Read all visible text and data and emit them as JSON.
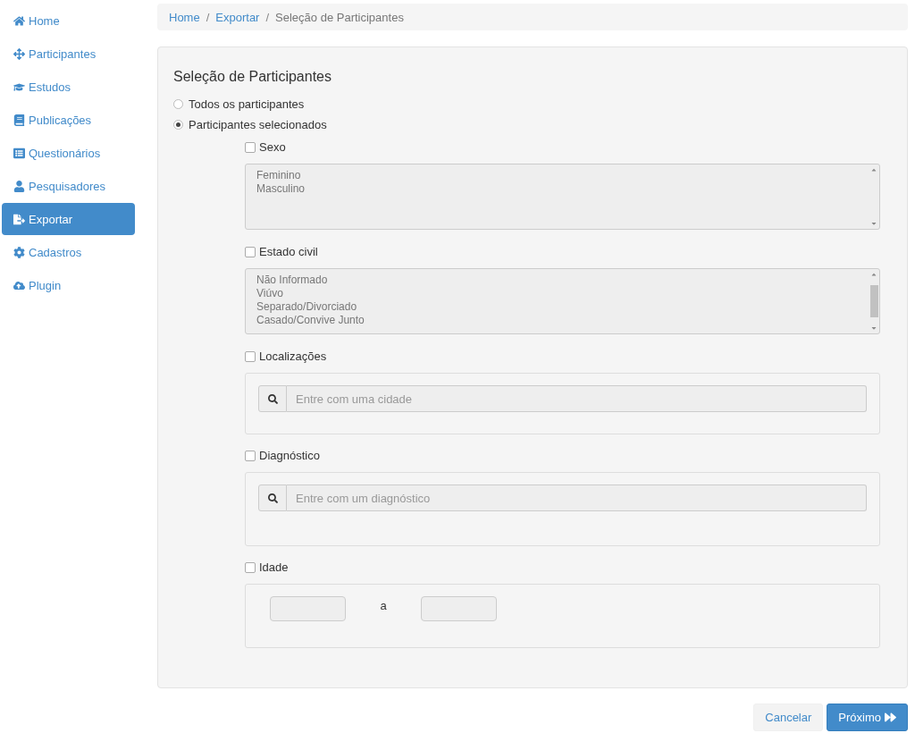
{
  "sidebar": {
    "items": [
      {
        "label": "Home",
        "kind": "home",
        "selected": false
      },
      {
        "label": "Participantes",
        "kind": "move",
        "selected": false
      },
      {
        "label": "Estudos",
        "kind": "cap",
        "selected": false
      },
      {
        "label": "Publicações",
        "kind": "book",
        "selected": false
      },
      {
        "label": "Questionários",
        "kind": "list",
        "selected": false
      },
      {
        "label": "Pesquisadores",
        "kind": "user",
        "selected": false
      },
      {
        "label": "Exportar",
        "kind": "export",
        "selected": true
      },
      {
        "label": "Cadastros",
        "kind": "cog",
        "selected": false
      },
      {
        "label": "Plugin",
        "kind": "cloud",
        "selected": false
      }
    ]
  },
  "breadcrumb_separator": "/",
  "breadcrumb": [
    {
      "label": "Home",
      "kind": "link"
    },
    {
      "label": "Exportar",
      "kind": "link"
    },
    {
      "label": "Seleção de Participantes",
      "kind": "current"
    }
  ],
  "panel": {
    "title": "Seleção de Participantes",
    "scope": [
      {
        "label": "Todos os participantes",
        "selected": false
      },
      {
        "label": "Participantes selecionados",
        "selected": true
      }
    ],
    "filters": [
      {
        "label": "Sexo",
        "checked": false,
        "kind": "list",
        "options": [
          "Feminino",
          "Masculino"
        ],
        "scrollable": false
      },
      {
        "label": "Estado civil",
        "checked": false,
        "kind": "list",
        "options": [
          "Não Informado",
          "Viúvo",
          "Separado/Divorciado",
          "Casado/Convive Junto"
        ],
        "scrollable": true
      },
      {
        "label": "Localizações",
        "checked": false,
        "kind": "search",
        "placeholder": "Entre com uma cidade"
      },
      {
        "label": "Diagnóstico",
        "checked": false,
        "kind": "search",
        "placeholder": "Entre com um diagnóstico"
      },
      {
        "label": "Idade",
        "checked": false,
        "kind": "range",
        "separator": "a"
      }
    ]
  },
  "buttons": [
    {
      "label": "Cancelar",
      "kind": "default"
    },
    {
      "label": "Próximo",
      "kind": "primary"
    }
  ]
}
